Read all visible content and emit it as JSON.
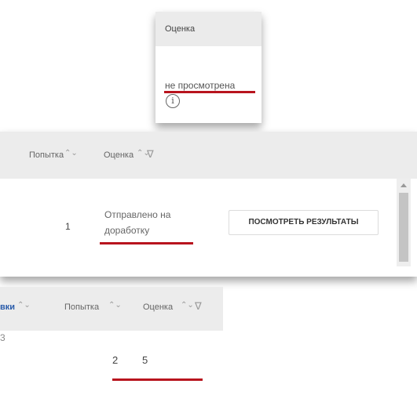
{
  "crop1": {
    "header": "Оценка",
    "status": "не просмотрена",
    "info_icon": "info-circle-icon"
  },
  "crop2": {
    "col_attempt": "Попытка",
    "col_grade": "Оценка",
    "sort_glyph": "⌃⌄",
    "filter_glyph": "∇",
    "row": {
      "attempt": "1",
      "grade": "Отправлено на доработку",
      "action": "ПОСМОТРЕТЬ РЕЗУЛЬТАТЫ"
    }
  },
  "crop3": {
    "col_partial": "вки",
    "col_attempt": "Попытка",
    "col_grade": "Оценка",
    "sort_glyph": "⌃⌄",
    "filter_glyph": "∇",
    "row": {
      "partial": "3",
      "attempt": "2",
      "grade": "5"
    }
  },
  "colors": {
    "highlight_underline": "#b8141e",
    "header_bg": "#ececec",
    "link_blue": "#2a5caa"
  }
}
